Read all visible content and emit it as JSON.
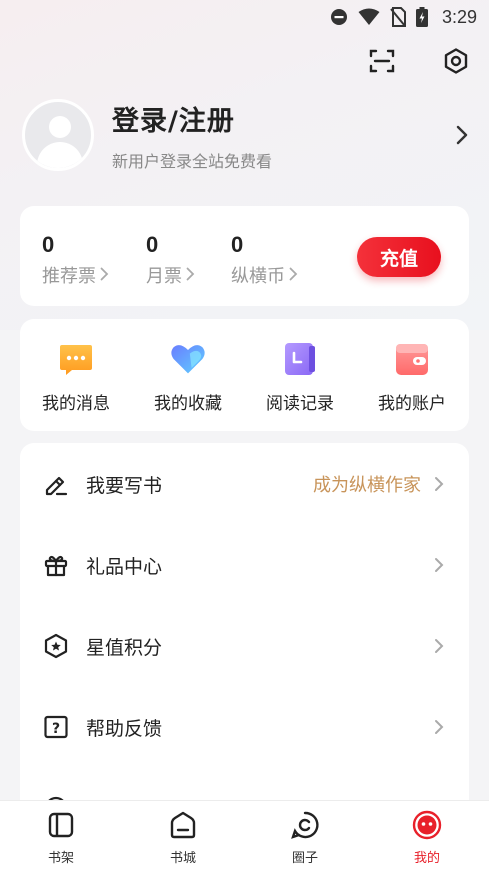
{
  "status_bar": {
    "time": "3:29"
  },
  "profile": {
    "title": "登录/注册",
    "subtitle": "新用户登录全站免费看"
  },
  "stats": [
    {
      "value": "0",
      "label": "推荐票"
    },
    {
      "value": "0",
      "label": "月票"
    },
    {
      "value": "0",
      "label": "纵横币"
    }
  ],
  "recharge_label": "充值",
  "shortcuts": [
    {
      "label": "我的消息",
      "icon": "message-icon"
    },
    {
      "label": "我的收藏",
      "icon": "heart-icon"
    },
    {
      "label": "阅读记录",
      "icon": "history-icon"
    },
    {
      "label": "我的账户",
      "icon": "wallet-icon"
    }
  ],
  "menu": [
    {
      "label": "我要写书",
      "extra": "成为纵横作家",
      "icon": "pen-icon"
    },
    {
      "label": "礼品中心",
      "extra": "",
      "icon": "gift-icon"
    },
    {
      "label": "星值积分",
      "extra": "",
      "icon": "star-badge-icon"
    },
    {
      "label": "帮助反馈",
      "extra": "",
      "icon": "help-icon"
    }
  ],
  "tabs": [
    {
      "label": "书架",
      "icon": "bookshelf-icon"
    },
    {
      "label": "书城",
      "icon": "bookstore-icon"
    },
    {
      "label": "圈子",
      "icon": "circle-icon"
    },
    {
      "label": "我的",
      "icon": "me-icon",
      "active": true
    }
  ],
  "colors": {
    "accent": "#e8202a",
    "author_link": "#c8945a"
  }
}
